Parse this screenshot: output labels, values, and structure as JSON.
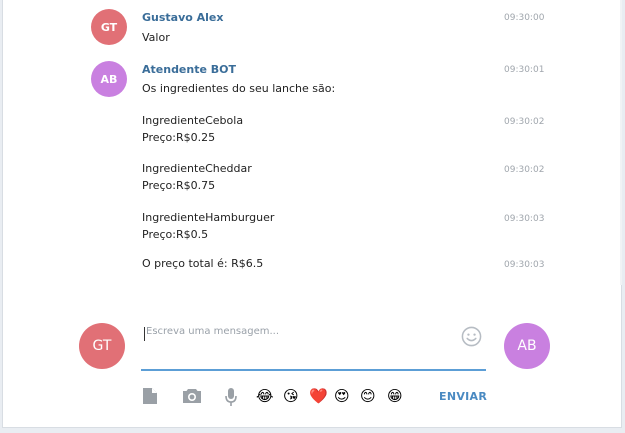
{
  "messages": [
    {
      "initials": "GT",
      "sender": "Gustavo Alex",
      "time": "09:30:00",
      "text": "Valor"
    },
    {
      "initials": "AB",
      "sender": "Atendente BOT",
      "time": "09:30:01",
      "text": "Os ingredientes do seu lanche são:"
    }
  ],
  "bot_lines": [
    {
      "text": "IngredienteCebola\nPreço:R$0.25",
      "time": "09:30:02"
    },
    {
      "text": "IngredienteCheddar\nPreço:R$0.75",
      "time": "09:30:02"
    },
    {
      "text": "IngredienteHamburguer\nPreço:R$0.5",
      "time": "09:30:03"
    },
    {
      "text": "O preço total é: R$6.5",
      "time": "09:30:03"
    }
  ],
  "composer": {
    "user_initials": "GT",
    "peer_initials": "AB",
    "placeholder": "Escreva uma mensagem...",
    "send_label": "ENVIAR"
  },
  "emojis": [
    "😂",
    "😘",
    "❤️",
    "😍",
    "😊",
    "😁"
  ],
  "colors": {
    "accent": "#4a8ac2",
    "user_avatar": "#e17076",
    "bot_avatar": "#c980e0"
  }
}
